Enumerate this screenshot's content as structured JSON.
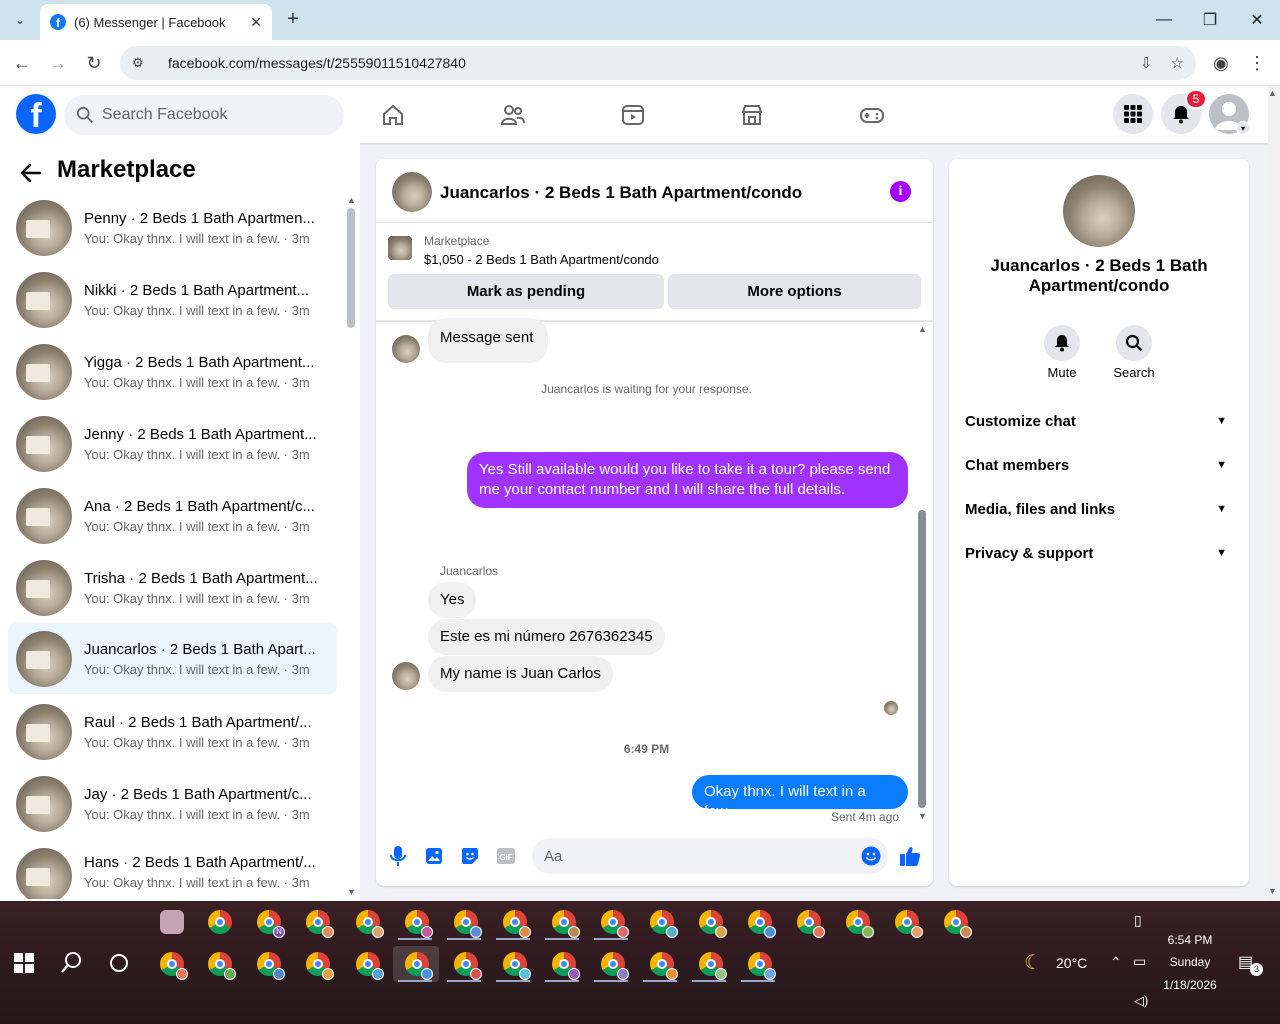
{
  "browser": {
    "tab_title": "(6) Messenger | Facebook",
    "url": "facebook.com/messages/t/25559011510427840",
    "icons": [
      "tab-search-icon",
      "close-icon",
      "plus-icon",
      "minimize-icon",
      "restore-icon",
      "back-icon",
      "forward-icon",
      "reload-icon",
      "site-settings-icon",
      "install-icon",
      "star-icon",
      "account-icon",
      "menu-icon"
    ]
  },
  "fb_header": {
    "logo": "f",
    "search_placeholder": "Search Facebook",
    "notif_count": "5"
  },
  "sidebar": {
    "title": "Marketplace",
    "conversations": [
      {
        "name": "Penny · 2 Beds 1 Bath Apartmen...",
        "preview": "You: Okay thnx. I will text in a few. · 3m"
      },
      {
        "name": "Nikki · 2 Beds 1 Bath Apartment...",
        "preview": "You: Okay thnx. I will text in a few. · 3m"
      },
      {
        "name": "Yigga · 2 Beds 1 Bath Apartment...",
        "preview": "You: Okay thnx. I will text in a few. · 3m"
      },
      {
        "name": "Jenny · 2 Beds 1 Bath Apartment...",
        "preview": "You: Okay thnx. I will text in a few. · 3m"
      },
      {
        "name": "Ana · 2 Beds 1 Bath Apartment/c...",
        "preview": "You: Okay thnx. I will text in a few. · 3m"
      },
      {
        "name": "Trisha · 2 Beds 1 Bath Apartment...",
        "preview": "You: Okay thnx. I will text in a few. · 3m"
      },
      {
        "name": "Juancarlos · 2 Beds 1 Bath Apart...",
        "preview": "You: Okay thnx. I will text in a few. · 3m"
      },
      {
        "name": "Raul · 2 Beds 1 Bath Apartment/...",
        "preview": "You: Okay thnx. I will text in a few. · 3m"
      },
      {
        "name": "Jay · 2 Beds 1 Bath Apartment/c...",
        "preview": "You: Okay thnx. I will text in a few. · 3m"
      },
      {
        "name": "Hans · 2 Beds 1 Bath Apartment/...",
        "preview": "You: Okay thnx. I will text in a few. · 3m"
      }
    ]
  },
  "chat": {
    "title": "Juancarlos · 2 Beds 1 Bath Apartment/condo",
    "marketplace_label": "Marketplace",
    "listing": "$1,050 - 2 Beds 1 Bath Apartment/condo",
    "mark_pending": "Mark as pending",
    "more_options": "More options",
    "msg_sent": "Message sent",
    "waiting": "Juancarlos is waiting for your response.",
    "out_msg_1": "Yes Still available would you like to take it a tour? please send me your contact number and I will share the full details.",
    "sender_label": "Juancarlos",
    "in_msg_1": "Yes",
    "in_msg_2": "Este es mi número 2676362345",
    "in_msg_3": "My name is Juan Carlos",
    "time": "6:49 PM",
    "out_msg_2": "Okay thnx. I will text in a few.",
    "sent_status": "Sent 4m ago",
    "composer_placeholder": "Aa",
    "accent_color": "#a033ff",
    "out_color_2": "#0a7cff"
  },
  "right_panel": {
    "name": "Juancarlos · 2 Beds 1 Bath Apartment/condo",
    "mute": "Mute",
    "search": "Search",
    "sections": [
      "Customize chat",
      "Chat members",
      "Media, files and links",
      "Privacy & support"
    ]
  },
  "taskbar": {
    "weather": "20°C",
    "time": "6:54 PM",
    "day": "Sunday",
    "date": "1/18/2026",
    "notif_count": "3",
    "profile_badge": "N"
  }
}
